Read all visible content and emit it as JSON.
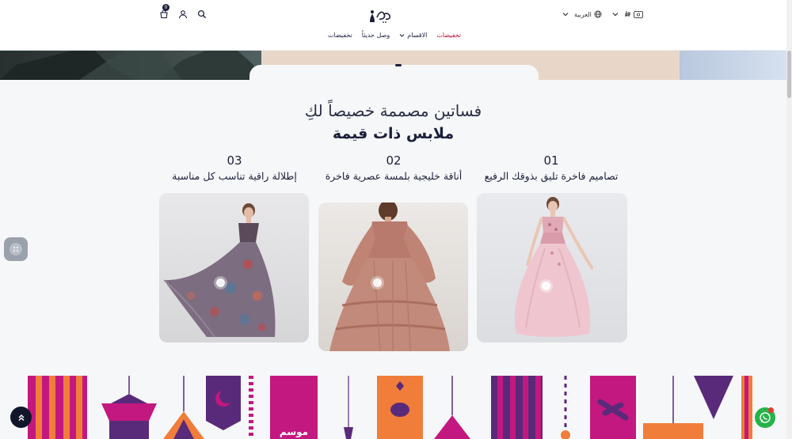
{
  "header": {
    "cart_count": "0",
    "language": "العربية",
    "nav": [
      {
        "label": "تخفيضات",
        "active": true
      },
      {
        "label": "الاقسام",
        "active": false,
        "has_dropdown": true
      },
      {
        "label": "وصل حديثاً",
        "active": false
      },
      {
        "label": "تخفيضات",
        "active": false
      }
    ],
    "icons": [
      "cart-icon",
      "user-icon",
      "search-icon",
      "globe-icon",
      "currency-icon",
      "chevron-down-icon"
    ]
  },
  "section": {
    "title": "فساتين مصممة خصيصاً لكِ",
    "subtitle": "ملابس ذات قيمة"
  },
  "features": [
    {
      "num": "01",
      "text": "تصاميم فاخرة تليق بذوقك الرفيع"
    },
    {
      "num": "02",
      "text": "أناقة خليجية بلمسة عصرية فاخرة"
    },
    {
      "num": "03",
      "text": "إطلالة راقية تناسب كل مناسبة"
    }
  ],
  "banner": {
    "text": "موسم"
  },
  "colors": {
    "accent": "#c0133a",
    "navy": "#1b1f3b",
    "magenta": "#c3187f",
    "orange": "#f07d3a",
    "purple": "#5a2a7a",
    "whatsapp": "#25b34a"
  }
}
